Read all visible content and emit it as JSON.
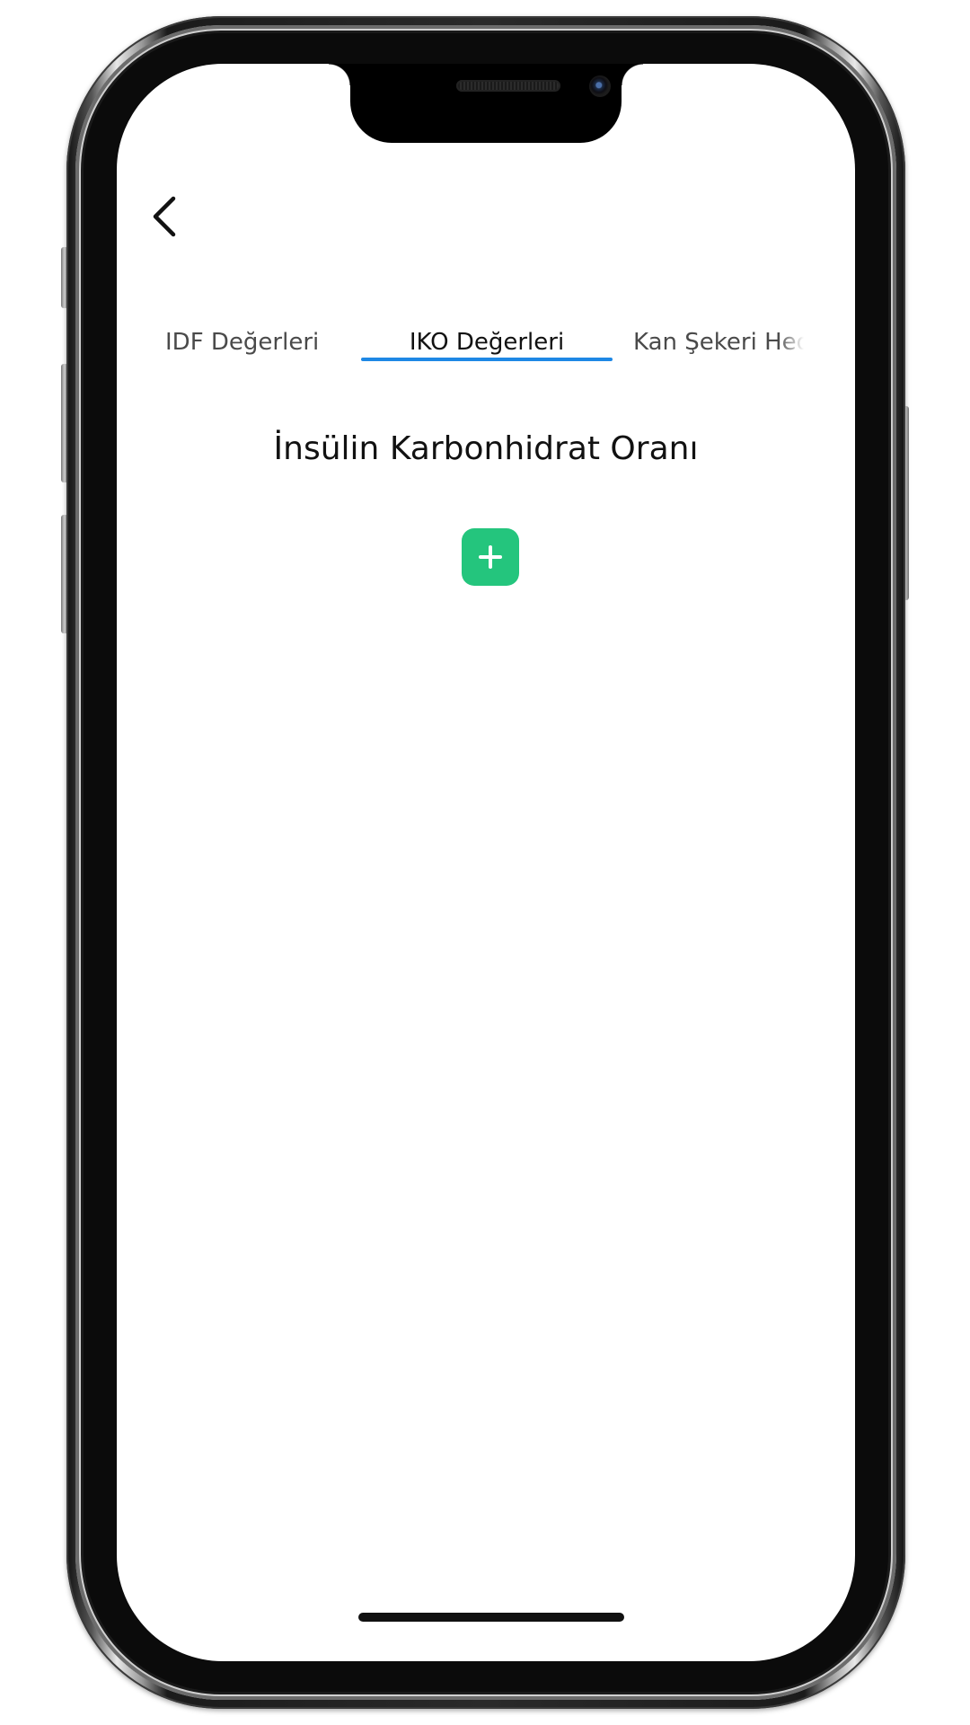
{
  "navigation": {
    "back_icon": "chevron-left-icon"
  },
  "tabs": [
    {
      "label": "IDF Değerleri",
      "selected": false
    },
    {
      "label": "IKO Değerleri",
      "selected": true
    },
    {
      "label": "Kan Şekeri Hedef",
      "selected": false
    }
  ],
  "main": {
    "title": "İnsülin Karbonhidrat Oranı",
    "add_icon": "plus-icon"
  },
  "colors": {
    "accent_tab_indicator": "#1e88e5",
    "add_button": "#24c57d"
  }
}
